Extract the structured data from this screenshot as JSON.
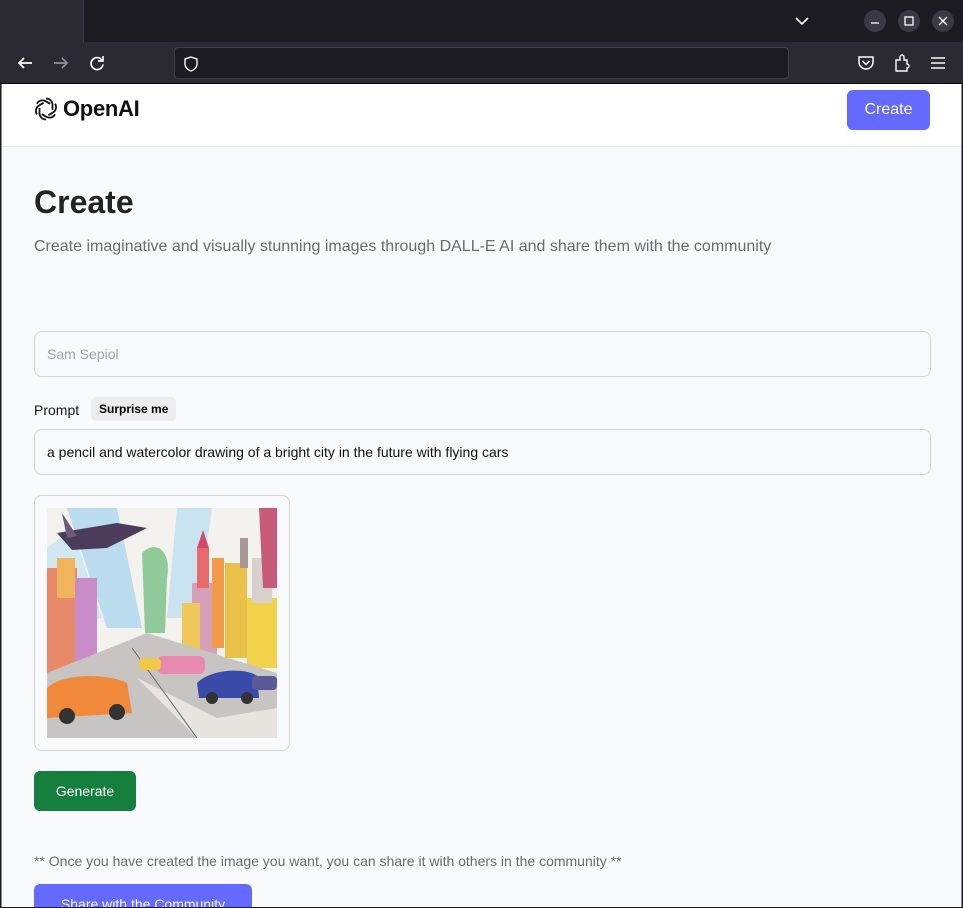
{
  "browser": {
    "url": "",
    "icons": [
      "back-arrow-icon",
      "forward-arrow-icon",
      "reload-icon",
      "shield-icon",
      "pocket-icon",
      "extensions-icon",
      "menu-icon",
      "list-tabs-icon",
      "minimize-icon",
      "maximize-icon",
      "close-icon"
    ]
  },
  "header": {
    "logo_text": "OpenAI",
    "create_label": "Create"
  },
  "main": {
    "title": "Create",
    "subtitle": "Create imaginative and visually stunning images through DALL-E AI and share them with the community"
  },
  "form": {
    "name_placeholder": "Sam Sepiol",
    "name_value": "",
    "prompt_label": "Prompt",
    "surprise_label": "Surprise me",
    "prompt_value": "a pencil and watercolor drawing of a bright city in the future with flying cars",
    "generate_label": "Generate"
  },
  "share": {
    "note": "** Once you have created the image you want, you can share it with others in the community **",
    "button_label": "Share with the Community"
  },
  "colors": {
    "accent": "#6469ff",
    "generate": "#15803d",
    "page_bg": "#f9fafe"
  }
}
